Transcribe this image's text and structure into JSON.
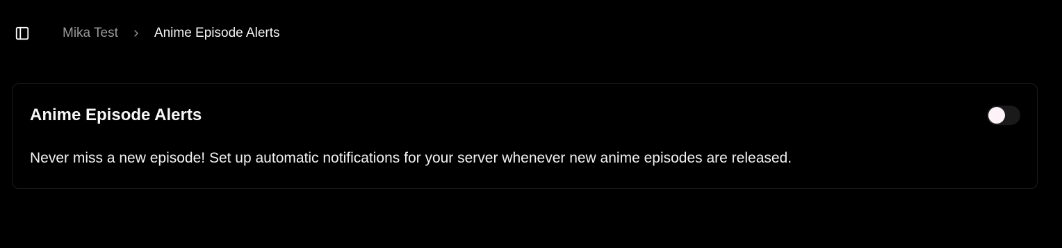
{
  "breadcrumb": {
    "parent": "Mika Test",
    "current": "Anime Episode Alerts"
  },
  "feature_card": {
    "title": "Anime Episode Alerts",
    "description": "Never miss a new episode! Set up automatic notifications for your server whenever new anime episodes are released.",
    "toggle_enabled": false
  },
  "icons": {
    "sidebar_toggle": "panel-left-icon",
    "breadcrumb_separator": "chevron-right-icon"
  },
  "colors": {
    "background": "#000000",
    "text_primary": "#f5f5f5",
    "text_muted": "#9a9a9a",
    "card_border": "#1c1c1c",
    "toggle_track_off": "#1a1a1a",
    "toggle_knob": "#fdf2f8"
  }
}
